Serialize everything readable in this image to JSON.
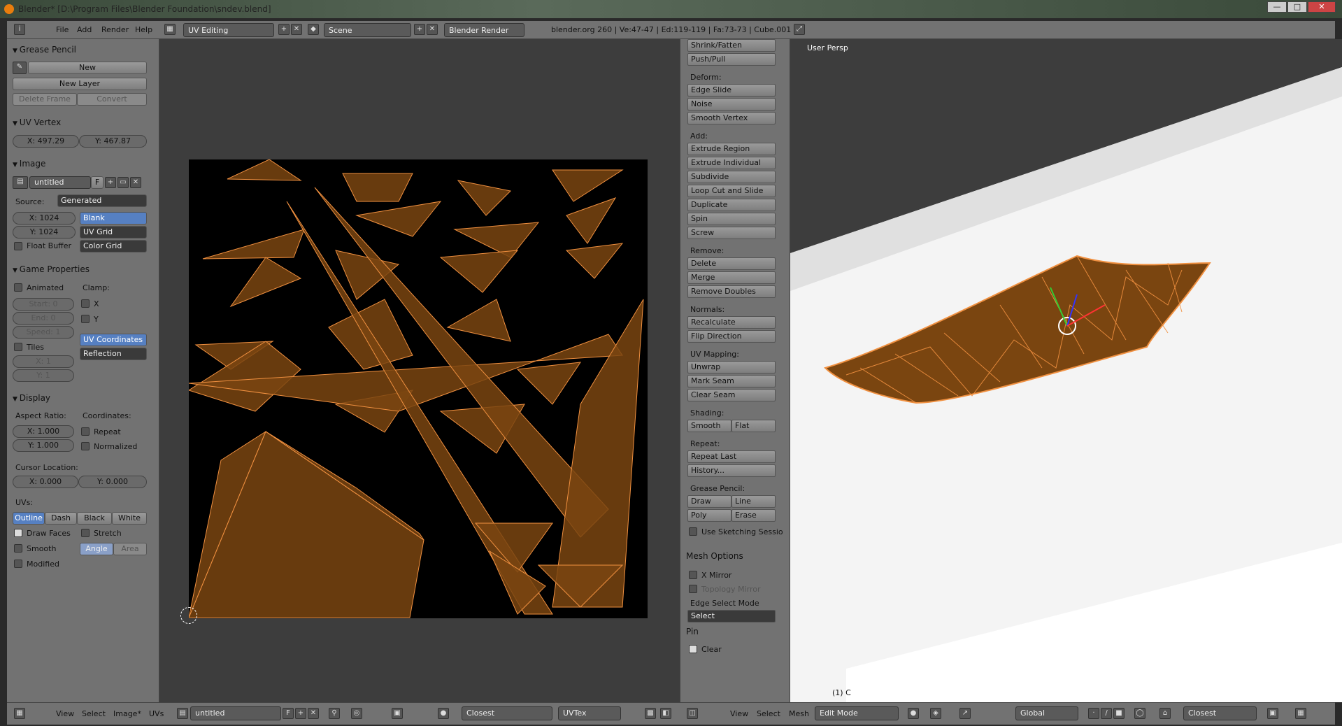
{
  "window": {
    "title": "Blender* [D:\\Program Files\\Blender Foundation\\sndev.blend]",
    "min": "—",
    "max": "□",
    "close": "✕"
  },
  "menubar": {
    "file": "File",
    "add": "Add",
    "render": "Render",
    "help": "Help",
    "layout": "UV Editing",
    "scene": "Scene",
    "engine": "Blender Render",
    "stats": "blender.org 260 | Ve:47-47 | Ed:119-119 | Fa:73-73 | Cube.001"
  },
  "left": {
    "grease": {
      "header": "Grease Pencil",
      "new": "New",
      "new_layer": "New Layer",
      "delete_frame": "Delete Frame",
      "convert": "Convert"
    },
    "uvvertex": {
      "header": "UV Vertex",
      "x": "X: 497.29",
      "y": "Y: 467.87"
    },
    "image": {
      "header": "Image",
      "name": "untitled",
      "f": "F",
      "source_label": "Source:",
      "source": "Generated",
      "x": "X: 1024",
      "y": "Y: 1024",
      "float_buffer": "Float Buffer",
      "blank": "Blank",
      "uv_grid": "UV Grid",
      "color_grid": "Color Grid"
    },
    "game": {
      "header": "Game Properties",
      "animated": "Animated",
      "clamp": "Clamp:",
      "start": "Start: 0",
      "end": "End: 0",
      "speed": "Speed: 1",
      "cx": "X",
      "cy": "Y",
      "tiles": "Tiles",
      "tx": "X: 1",
      "ty": "Y: 1",
      "uv_coords": "UV Coordinates",
      "reflection": "Reflection"
    },
    "display": {
      "header": "Display",
      "aspect": "Aspect Ratio:",
      "coords": "Coordinates:",
      "ax": "X: 1.000",
      "ay": "Y: 1.000",
      "repeat": "Repeat",
      "normalized": "Normalized",
      "cursor": "Cursor Location:",
      "curx": "X: 0.000",
      "cury": "Y: 0.000",
      "uvs": "UVs:",
      "outline": "Outline",
      "dash": "Dash",
      "black": "Black",
      "white": "White",
      "draw_faces": "Draw Faces",
      "stretch": "Stretch",
      "smooth": "Smooth",
      "angle": "Angle",
      "area": "Area",
      "modified": "Modified"
    }
  },
  "tools": {
    "top": [
      "Shrink/Fatten",
      "Push/Pull"
    ],
    "deform_label": "Deform:",
    "deform": [
      "Edge Slide",
      "Noise",
      "Smooth Vertex"
    ],
    "add_label": "Add:",
    "add": [
      "Extrude Region",
      "Extrude Individual",
      "Subdivide",
      "Loop Cut and Slide",
      "Duplicate",
      "Spin",
      "Screw"
    ],
    "remove_label": "Remove:",
    "remove": [
      "Delete",
      "Merge",
      "Remove Doubles"
    ],
    "normals_label": "Normals:",
    "normals": [
      "Recalculate",
      "Flip Direction"
    ],
    "uvmap_label": "UV Mapping:",
    "uvmap": [
      "Unwrap",
      "Mark Seam",
      "Clear Seam"
    ],
    "shading_label": "Shading:",
    "smooth": "Smooth",
    "flat": "Flat",
    "repeat_label": "Repeat:",
    "repeat": [
      "Repeat Last",
      "History..."
    ],
    "gp_label": "Grease Pencil:",
    "draw": "Draw",
    "line": "Line",
    "poly": "Poly",
    "erase": "Erase",
    "sketch": "Use Sketching Sessio",
    "mesh_options": "Mesh Options",
    "x_mirror": "X Mirror",
    "topo": "Topology Mirror",
    "edge_select": "Edge Select Mode",
    "select": "Select",
    "pin": "Pin",
    "clear": "Clear"
  },
  "view3d": {
    "label": "User Persp",
    "obj": "(1) C"
  },
  "status_left": {
    "view": "View",
    "select": "Select",
    "image": "Image*",
    "uvs": "UVs",
    "img": "untitled",
    "f": "F",
    "closest": "Closest",
    "uvtex": "UVTex"
  },
  "status_right": {
    "view": "View",
    "select": "Select",
    "mesh": "Mesh",
    "mode": "Edit Mode",
    "global": "Global",
    "closest": "Closest"
  }
}
